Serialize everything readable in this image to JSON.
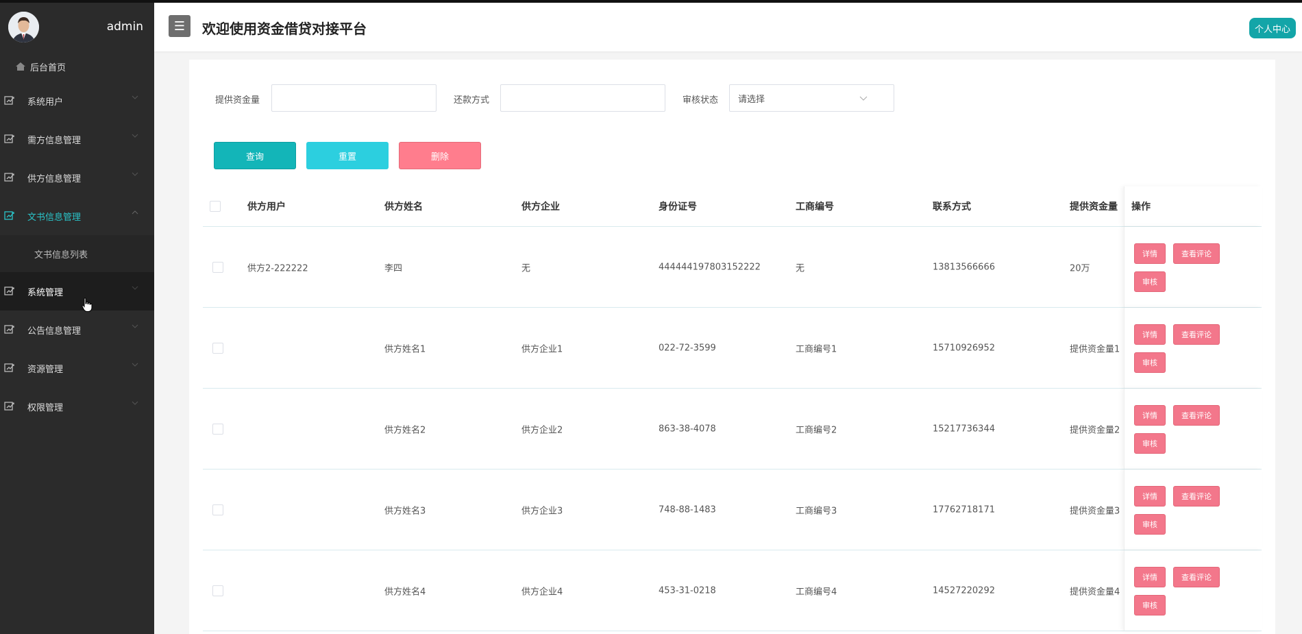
{
  "sidebar": {
    "username": "admin",
    "home_label": "后台首页",
    "menu": [
      {
        "label": "系统用户"
      },
      {
        "label": "需方信息管理"
      },
      {
        "label": "供方信息管理"
      },
      {
        "label": "文书信息管理"
      },
      {
        "label": "系统管理"
      },
      {
        "label": "公告信息管理"
      },
      {
        "label": "资源管理"
      },
      {
        "label": "权限管理"
      }
    ],
    "submenu_label": "文书信息列表",
    "accent_color": "#2ac3c8"
  },
  "header": {
    "menu_toggle_glyph": "☰",
    "title": "欢迎使用资金借贷对接平台",
    "personal_center": "个人中心"
  },
  "filters": {
    "amount_label": "提供资金量",
    "amount_value": "",
    "repay_label": "还款方式",
    "repay_value": "",
    "status_label": "审核状态",
    "status_placeholder": "请选择"
  },
  "buttons": {
    "query": "查询",
    "reset": "重置",
    "delete": "删除"
  },
  "table": {
    "columns": [
      "供方用户",
      "供方姓名",
      "供方企业",
      "身份证号",
      "工商编号",
      "联系方式",
      "提供资金量",
      "操作"
    ],
    "rows": [
      {
        "user": "供方2-222222",
        "name": "李四",
        "company": "无",
        "idno": "444444197803152222",
        "bizno": "无",
        "phone": "13813566666",
        "amount": "20万"
      },
      {
        "user": "",
        "name": "供方姓名1",
        "company": "供方企业1",
        "idno": "022-72-3599",
        "bizno": "工商编号1",
        "phone": "15710926952",
        "amount": "提供资金量1"
      },
      {
        "user": "",
        "name": "供方姓名2",
        "company": "供方企业2",
        "idno": "863-38-4078",
        "bizno": "工商编号2",
        "phone": "15217736344",
        "amount": "提供资金量2"
      },
      {
        "user": "",
        "name": "供方姓名3",
        "company": "供方企业3",
        "idno": "748-88-1483",
        "bizno": "工商编号3",
        "phone": "17762718171",
        "amount": "提供资金量3"
      },
      {
        "user": "",
        "name": "供方姓名4",
        "company": "供方企业4",
        "idno": "453-31-0218",
        "bizno": "工商编号4",
        "phone": "14527220292",
        "amount": "提供资金量4"
      }
    ],
    "actions": {
      "detail": "详情",
      "comments": "查看评论",
      "audit": "审核"
    },
    "action_color": "#f3778b"
  }
}
